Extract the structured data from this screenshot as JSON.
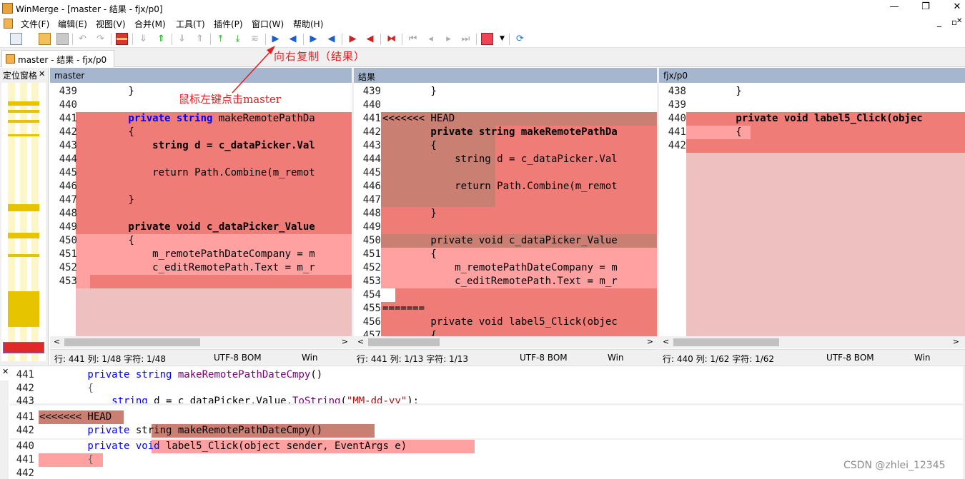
{
  "window": {
    "title": "WinMerge - [master - 结果 - fjx/p0]",
    "min": "—",
    "max": "❐",
    "close": "✕",
    "mdi_min": "_",
    "mdi_restore": "▫",
    "mdi_close": "✕"
  },
  "menu": [
    "文件(F)",
    "编辑(E)",
    "视图(V)",
    "合并(M)",
    "工具(T)",
    "插件(P)",
    "窗口(W)",
    "帮助(H)"
  ],
  "tab": {
    "label": "master - 结果 - fjx/p0"
  },
  "location_pane": {
    "title": "定位窗格",
    "close": "✕"
  },
  "annotations": {
    "copy_right": "向右复制（结果）",
    "click_master": "鼠标左键点击master"
  },
  "panes": [
    {
      "header": "master",
      "status": {
        "pos": "行: 441  列: 1/48  字符: 1/48",
        "enc": "UTF-8 BOM",
        "eol": "Win"
      },
      "lines": [
        {
          "n": "439",
          "t": "        }"
        },
        {
          "n": "440",
          "t": ""
        },
        {
          "n": "441",
          "t": "        private string makeRemotePathDa"
        },
        {
          "n": "442",
          "t": "        {"
        },
        {
          "n": "443",
          "t": "            string d = c_dataPicker.Val"
        },
        {
          "n": "444",
          "t": ""
        },
        {
          "n": "445",
          "t": "            return Path.Combine(m_remot"
        },
        {
          "n": "446",
          "t": ""
        },
        {
          "n": "447",
          "t": "        }"
        },
        {
          "n": "448",
          "t": ""
        },
        {
          "n": "449",
          "t": "        private void c_dataPicker_Value"
        },
        {
          "n": "450",
          "t": "        {"
        },
        {
          "n": "451",
          "t": "            m_remotePathDateCompany = m"
        },
        {
          "n": "452",
          "t": "            c_editRemotePath.Text = m_r"
        },
        {
          "n": "453",
          "t": ""
        }
      ]
    },
    {
      "header": "结果",
      "status": {
        "pos": "行: 441  列: 1/13  字符: 1/13",
        "enc": "UTF-8 BOM",
        "eol": "Win"
      },
      "lines": [
        {
          "n": "439",
          "t": "        }"
        },
        {
          "n": "440",
          "t": ""
        },
        {
          "n": "441",
          "t": "<<<<<<< HEAD"
        },
        {
          "n": "442",
          "t": "        private string makeRemotePathDa"
        },
        {
          "n": "443",
          "t": "        {"
        },
        {
          "n": "444",
          "t": "            string d = c_dataPicker.Val"
        },
        {
          "n": "445",
          "t": ""
        },
        {
          "n": "446",
          "t": "            return Path.Combine(m_remot"
        },
        {
          "n": "447",
          "t": ""
        },
        {
          "n": "448",
          "t": "        }"
        },
        {
          "n": "449",
          "t": ""
        },
        {
          "n": "450",
          "t": "        private void c_dataPicker_Value"
        },
        {
          "n": "451",
          "t": "        {"
        },
        {
          "n": "452",
          "t": "            m_remotePathDateCompany = m"
        },
        {
          "n": "453",
          "t": "            c_editRemotePath.Text = m_r"
        },
        {
          "n": "454",
          "t": ""
        },
        {
          "n": "455",
          "t": "======="
        },
        {
          "n": "456",
          "t": "        private void label5_Click(objec"
        },
        {
          "n": "457",
          "t": "        {"
        }
      ]
    },
    {
      "header": "fjx/p0",
      "status": {
        "pos": "行: 440  列: 1/62  字符: 1/62",
        "enc": "UTF-8 BOM",
        "eol": "Win"
      },
      "lines": [
        {
          "n": "438",
          "t": "        }"
        },
        {
          "n": "439",
          "t": ""
        },
        {
          "n": "440",
          "t": "        private void label5_Click(objec"
        },
        {
          "n": "441",
          "t": "        {"
        },
        {
          "n": "442",
          "t": ""
        }
      ]
    }
  ],
  "diff_lines": [
    {
      "n": "441",
      "t": "        private string makeRemotePathDateCmpy()"
    },
    {
      "n": "442",
      "t": "        {"
    },
    {
      "n": "443",
      "t": "            string d = c_dataPicker.Value.ToString(\"MM-dd-yy\");"
    },
    {
      "n": "441",
      "t": "<<<<<<< HEAD"
    },
    {
      "n": "442",
      "t": "        private string makeRemotePathDateCmpy()"
    },
    {
      "n": "440",
      "t": "        private void label5_Click(object sender, EventArgs e)"
    },
    {
      "n": "441",
      "t": "        {"
    },
    {
      "n": "442",
      "t": ""
    }
  ],
  "watermark": "CSDN @zhlei_12345",
  "colors": {
    "diff_sel": "#f07c78",
    "diff_light": "#ffa1a1",
    "diff_pad": "#efc0c0",
    "merged": "#c97f72",
    "header": "#a6b6cf"
  }
}
